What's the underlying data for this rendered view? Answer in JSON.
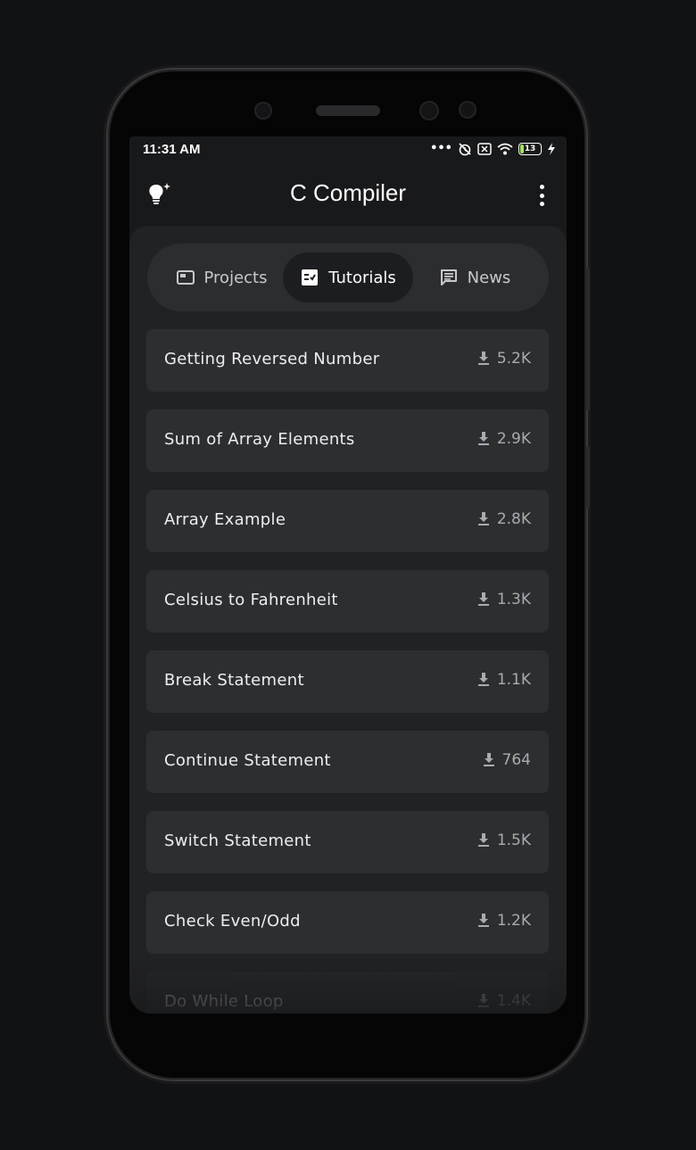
{
  "status_bar": {
    "time": "11:31 AM",
    "battery_level": "13",
    "icons": [
      "dots-icon",
      "alarm-off-icon",
      "sim-off-icon",
      "wifi-icon",
      "battery-icon",
      "charging-icon"
    ]
  },
  "app_bar": {
    "title": "C Compiler",
    "left_icon": "lightbulb-icon",
    "right_icon": "more-vert-icon"
  },
  "tabs": [
    {
      "label": "Projects",
      "icon": "projects-icon",
      "active": false
    },
    {
      "label": "Tutorials",
      "icon": "tutorials-icon",
      "active": true
    },
    {
      "label": "News",
      "icon": "news-icon",
      "active": false
    }
  ],
  "tutorials": [
    {
      "title": "Getting Reversed Number",
      "downloads": "5.2K"
    },
    {
      "title": "Sum of Array Elements",
      "downloads": "2.9K"
    },
    {
      "title": "Array Example",
      "downloads": "2.8K"
    },
    {
      "title": "Celsius to Fahrenheit",
      "downloads": "1.3K"
    },
    {
      "title": "Break Statement",
      "downloads": "1.1K"
    },
    {
      "title": "Continue Statement",
      "downloads": "764"
    },
    {
      "title": "Switch Statement",
      "downloads": "1.5K"
    },
    {
      "title": "Check Even/Odd",
      "downloads": "1.2K"
    },
    {
      "title": "Do While Loop",
      "downloads": "1.4K"
    }
  ],
  "colors": {
    "background": "#111214",
    "screen": "#18191b",
    "content": "#212225",
    "card": "#2c2e31",
    "active_tab": "#1c1d20",
    "battery_fill": "#a7e15c"
  }
}
